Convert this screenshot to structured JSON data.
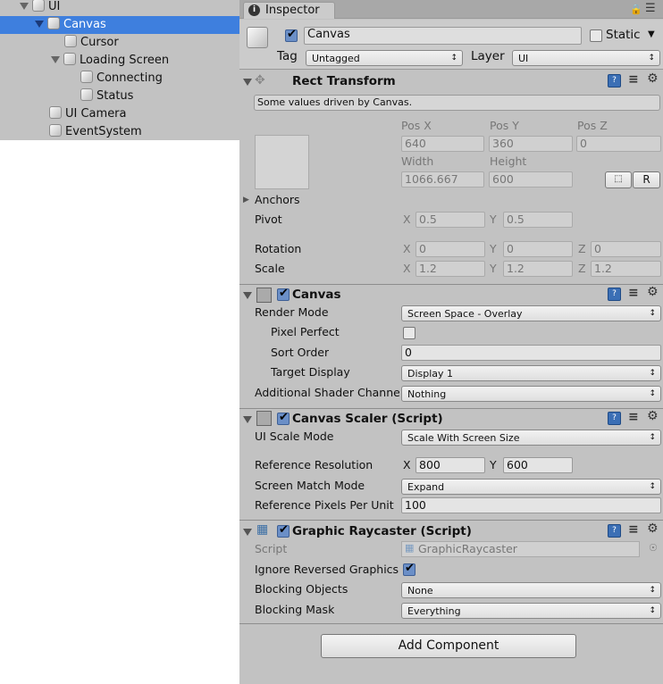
{
  "hierarchy": {
    "items": [
      {
        "label": "UI",
        "expanded": true,
        "selected": false
      },
      {
        "label": "Canvas",
        "expanded": true,
        "selected": true
      },
      {
        "label": "Cursor"
      },
      {
        "label": "Loading Screen",
        "expanded": true
      },
      {
        "label": "Connecting"
      },
      {
        "label": "Status"
      },
      {
        "label": "UI Camera"
      },
      {
        "label": "EventSystem"
      }
    ]
  },
  "inspector": {
    "tab": "Inspector",
    "object": {
      "active": true,
      "name": "Canvas",
      "static_label": "Static",
      "static": false,
      "tag_label": "Tag",
      "tag": "Untagged",
      "layer_label": "Layer",
      "layer": "UI"
    },
    "rect_transform": {
      "title": "Rect Transform",
      "info": "Some values driven by Canvas.",
      "pos_x_label": "Pos X",
      "pos_y_label": "Pos Y",
      "pos_z_label": "Pos Z",
      "pos_x": "640",
      "pos_y": "360",
      "pos_z": "0",
      "width_label": "Width",
      "height_label": "Height",
      "width": "1066.667",
      "height": "600",
      "r_button": "R",
      "anchors_label": "Anchors",
      "pivot_label": "Pivot",
      "pivot_x": "0.5",
      "pivot_y": "0.5",
      "rotation_label": "Rotation",
      "rot_x": "0",
      "rot_y": "0",
      "rot_z": "0",
      "scale_label": "Scale",
      "scale_x": "1.2",
      "scale_y": "1.2",
      "scale_z": "1.2",
      "x": "X",
      "y": "Y",
      "z": "Z"
    },
    "canvas": {
      "title": "Canvas",
      "enabled": true,
      "render_mode_label": "Render Mode",
      "render_mode": "Screen Space - Overlay",
      "pixel_perfect_label": "Pixel Perfect",
      "pixel_perfect": false,
      "sort_order_label": "Sort Order",
      "sort_order": "0",
      "target_display_label": "Target Display",
      "target_display": "Display 1",
      "shader_channels_label": "Additional Shader Channels",
      "shader_channels": "Nothing"
    },
    "canvas_scaler": {
      "title": "Canvas Scaler (Script)",
      "enabled": true,
      "ui_scale_mode_label": "UI Scale Mode",
      "ui_scale_mode": "Scale With Screen Size",
      "ref_res_label": "Reference Resolution",
      "ref_x": "800",
      "ref_y": "600",
      "match_mode_label": "Screen Match Mode",
      "match_mode": "Expand",
      "ref_ppu_label": "Reference Pixels Per Unit",
      "ref_ppu": "100"
    },
    "graphic_raycaster": {
      "title": "Graphic Raycaster (Script)",
      "enabled": true,
      "script_label": "Script",
      "script": "GraphicRaycaster",
      "ignore_reversed_label": "Ignore Reversed Graphics",
      "ignore_reversed": true,
      "blocking_objects_label": "Blocking Objects",
      "blocking_objects": "None",
      "blocking_mask_label": "Blocking Mask",
      "blocking_mask": "Everything"
    },
    "add_component": "Add Component"
  },
  "colors": {
    "selection": "#3e7fde",
    "panel": "#c2c2c2"
  }
}
